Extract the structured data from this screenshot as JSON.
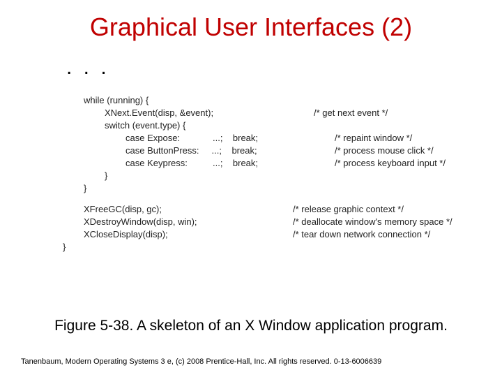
{
  "title": "Graphical User Interfaces (2)",
  "ellipsis": ". . .",
  "code": {
    "l1": "while (running) {",
    "l2": "XNext.Event(disp, &event);",
    "c2": "/* get next event */",
    "l3": "switch (event.type) {",
    "l4": "case Expose:             ...;    break;",
    "c4": "/* repaint window */",
    "l5": "case ButtonPress:     ...;    break;",
    "c5": "/* process mouse click */",
    "l6": "case Keypress:          ...;    break;",
    "c6": "/* process keyboard input */",
    "l7": "}",
    "l8": "}",
    "l9": "XFreeGC(disp, gc);",
    "c9": "/* release graphic context */",
    "l10": "XDestroyWindow(disp, win);",
    "c10": "/* deallocate window's memory space */",
    "l11": "XCloseDisplay(disp);",
    "c11": "/* tear down network connection */",
    "l12": "}"
  },
  "caption": "Figure 5-38. A skeleton of an X Window application program.",
  "footnote": "Tanenbaum, Modern Operating Systems 3 e, (c) 2008 Prentice-Hall, Inc. All rights reserved. 0-13-6006639"
}
